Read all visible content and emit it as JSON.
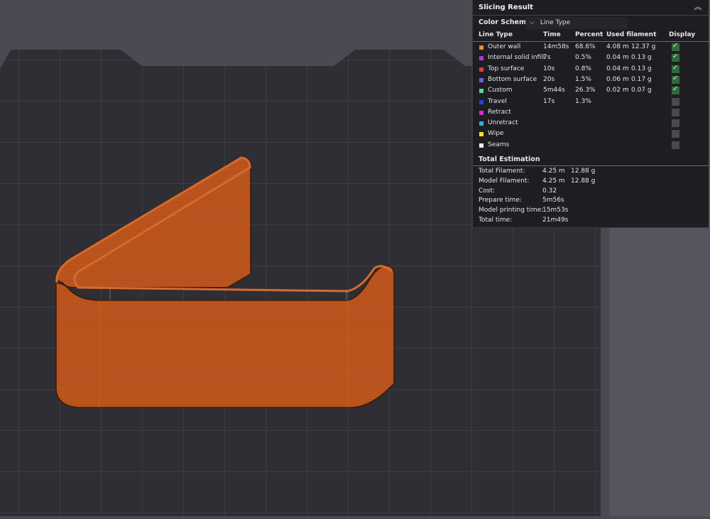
{
  "panel": {
    "title": "Slicing Result",
    "color_scheme_label": "Color Scheme",
    "color_scheme_value": "Line Type",
    "columns": [
      "Line Type",
      "Time",
      "Percent",
      "Used filament",
      "Display"
    ],
    "rows": [
      {
        "name": "Outer wall",
        "color": "#f08a2a",
        "time": "14m58s",
        "percent": "68.6%",
        "len": "4.08 m",
        "weight": "12.37 g",
        "display": true
      },
      {
        "name": "Internal solid infill",
        "color": "#a040d0",
        "time": "7s",
        "percent": "0.5%",
        "len": "0.04 m",
        "weight": "0.13 g",
        "display": true
      },
      {
        "name": "Top surface",
        "color": "#e03a3a",
        "time": "10s",
        "percent": "0.8%",
        "len": "0.04 m",
        "weight": "0.13 g",
        "display": true
      },
      {
        "name": "Bottom surface",
        "color": "#6a64d8",
        "time": "20s",
        "percent": "1.5%",
        "len": "0.06 m",
        "weight": "0.17 g",
        "display": true
      },
      {
        "name": "Custom",
        "color": "#5ed69a",
        "time": "5m44s",
        "percent": "26.3%",
        "len": "0.02 m",
        "weight": "0.07 g",
        "display": true
      },
      {
        "name": "Travel",
        "color": "#2a3fd0",
        "time": "17s",
        "percent": "1.3%",
        "len": "",
        "weight": "",
        "display": false
      },
      {
        "name": "Retract",
        "color": "#d030d0",
        "time": "",
        "percent": "",
        "len": "",
        "weight": "",
        "display": false
      },
      {
        "name": "Unretract",
        "color": "#30b0e0",
        "time": "",
        "percent": "",
        "len": "",
        "weight": "",
        "display": false
      },
      {
        "name": "Wipe",
        "color": "#f0e020",
        "time": "",
        "percent": "",
        "len": "",
        "weight": "",
        "display": false
      },
      {
        "name": "Seams",
        "color": "#f0f0f0",
        "time": "",
        "percent": "",
        "len": "",
        "weight": "",
        "display": false
      }
    ],
    "total_estimation_label": "Total Estimation",
    "estimation": [
      {
        "label": "Total Filament:",
        "value": "4.25 m",
        "extra": "12.88 g"
      },
      {
        "label": "Model Filament:",
        "value": "4.25 m",
        "extra": "12.88 g"
      },
      {
        "label": "Cost:",
        "value": "0.32",
        "extra": ""
      },
      {
        "label": "Prepare time:",
        "value": "5m56s",
        "extra": ""
      },
      {
        "label": "Model printing time:",
        "value": "15m53s",
        "extra": ""
      },
      {
        "label": "Total time:",
        "value": "21m49s",
        "extra": ""
      }
    ]
  },
  "colors": {
    "accent": "#c9561a",
    "bed": "#2e2e34",
    "background": "#4a4a53"
  }
}
